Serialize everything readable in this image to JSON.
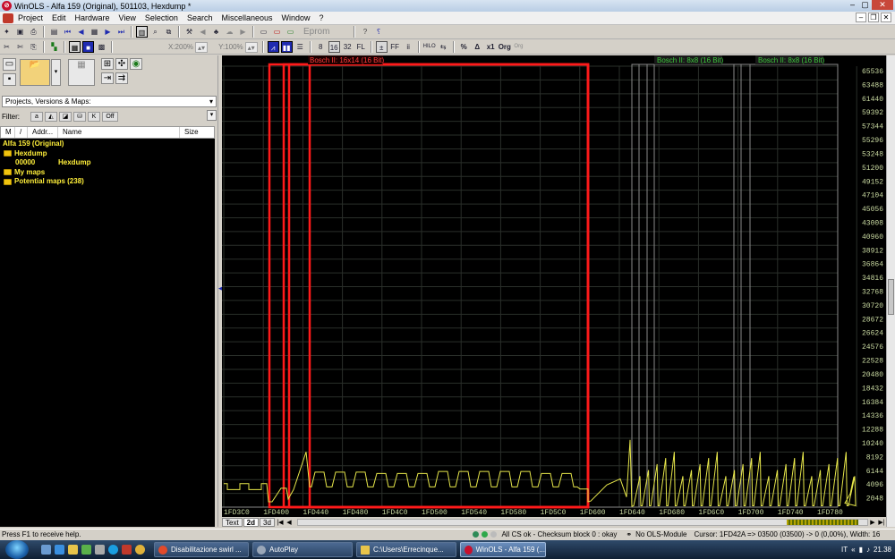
{
  "window": {
    "title": "WinOLS - Alfa 159 (Original), 501103, Hexdump *",
    "app_icon": "winols-logo-icon"
  },
  "menu": [
    "Project",
    "Edit",
    "Hardware",
    "View",
    "Selection",
    "Search",
    "Miscellaneous",
    "Window",
    "?"
  ],
  "toolbar": {
    "eprom_label": "Eprom",
    "zoom_x": "X:200%",
    "zoom_y": "Y:100%",
    "org_label": "Org",
    "bit_buttons": [
      "8",
      "16",
      "32",
      "FL"
    ],
    "hilo_label": "HILO",
    "x1_label": "x1"
  },
  "left_panel": {
    "projects_dropdown": "Projects, Versions & Maps:",
    "filter_label": "Filter:",
    "filter_off": "Off",
    "columns": [
      "M",
      "/",
      "Addr...",
      "Name",
      "Size"
    ],
    "tree": [
      {
        "indent": 0,
        "type": "root",
        "text": "Alfa 159 (Original)"
      },
      {
        "indent": 1,
        "type": "folder",
        "text": "Hexdump"
      },
      {
        "indent": 2,
        "type": "item",
        "addr": "00000",
        "name": "Hexdump"
      },
      {
        "indent": 1,
        "type": "folder",
        "text": "My maps"
      },
      {
        "indent": 1,
        "type": "folder",
        "text": "Potential maps (238)"
      }
    ]
  },
  "graph": {
    "map_labels": [
      {
        "text": "Bosch II: 16x14 (16 Bit)",
        "color": "#ff3b3b"
      },
      {
        "text": "Bosch II: 8x8 (16 Bit)",
        "color": "#3cc83c"
      },
      {
        "text": "Bosch II: 8x8 (16 Bit)",
        "color": "#3cc83c"
      }
    ],
    "y_ticks": [
      "65536",
      "63488",
      "61440",
      "59392",
      "57344",
      "55296",
      "53248",
      "51200",
      "49152",
      "47104",
      "45056",
      "43008",
      "40960",
      "38912",
      "36864",
      "34816",
      "32768",
      "30720",
      "28672",
      "26624",
      "24576",
      "22528",
      "20480",
      "18432",
      "16384",
      "14336",
      "12288",
      "10240",
      "8192",
      "6144",
      "4096",
      "2048"
    ],
    "x_ticks": [
      "1FD3C0",
      "1FD400",
      "1FD440",
      "1FD480",
      "1FD4C0",
      "1FD500",
      "1FD540",
      "1FD580",
      "1FD5C0",
      "1FD600",
      "1FD640",
      "1FD680",
      "1FD6C0",
      "1FD700",
      "1FD740",
      "1FD780"
    ],
    "line_color": "#e6e64a",
    "selection_color": "#ff1a1a"
  },
  "tabs": [
    "Text",
    "2d",
    "3d"
  ],
  "active_tab": "2d",
  "status": {
    "help": "Press F1 to receive help.",
    "checksum": "All CS ok - Checksum block 0 : okay",
    "module": "No OLS-Module",
    "cursor": "Cursor: 1FD42A => 03500 (03500) -> 0 (0,00%), Width: 16"
  },
  "taskbar": {
    "tasks": [
      {
        "label": "Disabilitazione swirl ...",
        "icon_color": "#e24a2b",
        "active": false
      },
      {
        "label": "AutoPlay",
        "icon_color": "#9aa7b8",
        "active": false
      },
      {
        "label": "C:\\Users\\Errecinque...",
        "icon_color": "#e8c44a",
        "active": false
      },
      {
        "label": "WinOLS - Alfa 159 (...",
        "icon_color": "#c8102e",
        "active": true
      }
    ],
    "lang": "IT",
    "clock": "21.38"
  }
}
